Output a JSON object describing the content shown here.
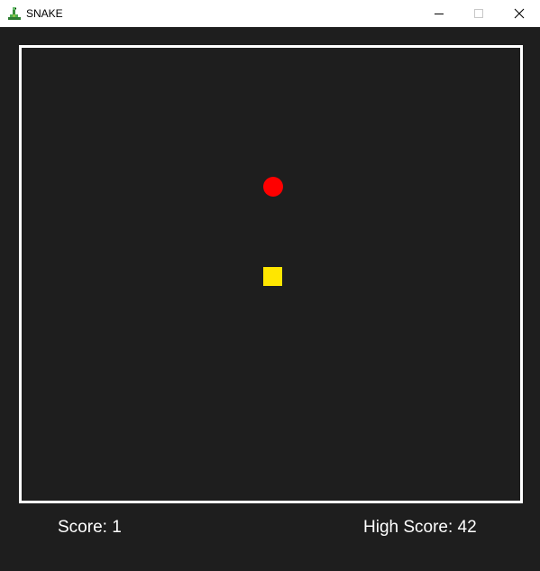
{
  "window": {
    "title": "SNAKE",
    "controls": {
      "minimize_icon": "minimize-icon",
      "maximize_icon": "maximize-icon",
      "close_icon": "close-icon"
    }
  },
  "game": {
    "food_color": "#ff0000",
    "snake_color": "#ffe600",
    "border_color": "#ffffff",
    "background_color": "#1e1e1e"
  },
  "hud": {
    "score_label": "Score: 1",
    "high_score_label": "High Score: 42"
  }
}
